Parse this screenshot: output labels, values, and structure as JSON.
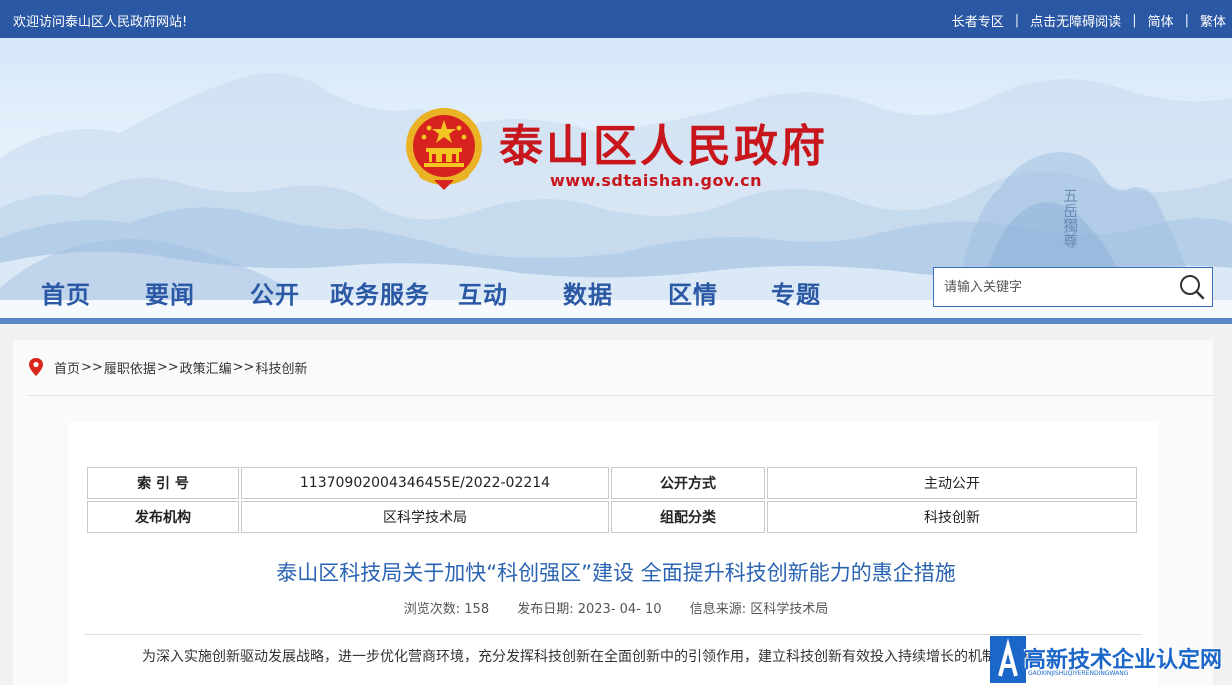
{
  "topbar": {
    "welcome": "欢迎访问泰山区人民政府网站!",
    "links": [
      "长者专区",
      "点击无障碍阅读",
      "简体",
      "繁体"
    ]
  },
  "header": {
    "title": "泰山区人民政府",
    "url": "www.sdtaishan.gov.cn"
  },
  "nav": {
    "items": [
      "首页",
      "要闻",
      "公开",
      "政务服务",
      "互动",
      "数据",
      "区情",
      "专题"
    ]
  },
  "search": {
    "placeholder": "请输入关键字"
  },
  "breadcrumb": {
    "items": [
      "首页",
      "履职依据",
      "政策汇编",
      "科技创新"
    ],
    "separator": ">>"
  },
  "info_table": {
    "rows": [
      {
        "k1": "索 引 号",
        "v1": "11370902004346455E/2022-02214",
        "k2": "公开方式",
        "v2": "主动公开"
      },
      {
        "k1": "发布机构",
        "v1": "区科学技术局",
        "k2": "组配分类",
        "v2": "科技创新"
      }
    ]
  },
  "article": {
    "title": "泰山区科技局关于加快“科创强区”建设 全面提升科技创新能力的惠企措施",
    "views_label": "浏览次数: 158",
    "date_label": "发布日期:  2023- 04- 10",
    "source_label": "信息来源:  区科学技术局",
    "paragraph": "为深入实施创新驱动发展战略，进一步优化营商环境，充分发挥科技创新在全面创新中的引领作用，建立科技创新有效投入持续增长的机制，推进"
  },
  "watermark": {
    "text": "高新技术企业认定网",
    "sub": "GAOXINJISHUQIYERENDINGWANG"
  },
  "colors": {
    "primary_blue": "#2a58a5",
    "title_red": "#c8161d",
    "article_title_blue": "#2a64b2"
  }
}
